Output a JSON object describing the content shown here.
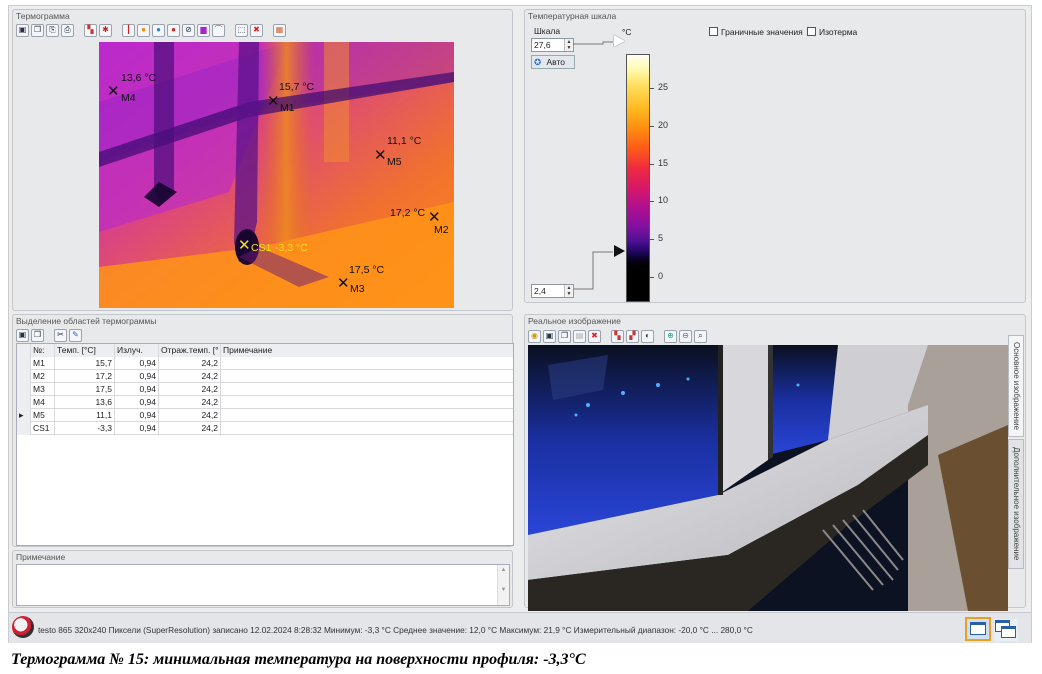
{
  "panels": {
    "thermogram": "Термограмма",
    "scale": "Температурная шкала",
    "regions": "Выделение областей термограммы",
    "note": "Примечание",
    "real_image": "Реальное изображение"
  },
  "scale": {
    "label": "Шкала",
    "unit": "°C",
    "max_value": "27,6",
    "min_value": "2,4",
    "auto_button": "Авто",
    "limits_checkbox": "Граничные значения",
    "isotherm_checkbox": "Изотерма",
    "ticks": [
      "25",
      "20",
      "15",
      "10",
      "5",
      "0"
    ],
    "upper_marker_value": 27.6,
    "lower_marker_value": 2.4,
    "range": [
      -3.3,
      29.5
    ]
  },
  "markers": [
    {
      "name": "M4",
      "value": "13,6 °C"
    },
    {
      "name": "M1",
      "value": "15,7 °C"
    },
    {
      "name": "M5",
      "value": "11,1 °C"
    },
    {
      "name": "M2",
      "value": "17,2 °C"
    },
    {
      "name": "CS1",
      "value": "-3,3 °C"
    },
    {
      "name": "M3",
      "value": "17,5 °C"
    }
  ],
  "table": {
    "columns": [
      "№:",
      "Темп. [°C]",
      "Излуч.",
      "Отраж.темп. [°",
      "Примечание"
    ],
    "rows": [
      {
        "id": "M1",
        "temp": "15,7",
        "emiss": "0,94",
        "refl": "24,2",
        "note": ""
      },
      {
        "id": "M2",
        "temp": "17,2",
        "emiss": "0,94",
        "refl": "24,2",
        "note": ""
      },
      {
        "id": "M3",
        "temp": "17,5",
        "emiss": "0,94",
        "refl": "24,2",
        "note": ""
      },
      {
        "id": "M4",
        "temp": "13,6",
        "emiss": "0,94",
        "refl": "24,2",
        "note": ""
      },
      {
        "id": "M5",
        "temp": "11,1",
        "emiss": "0,94",
        "refl": "24,2",
        "note": ""
      },
      {
        "id": "CS1",
        "temp": "-3,3",
        "emiss": "0,94",
        "refl": "24,2",
        "note": ""
      }
    ],
    "selected_row_marker": "▸"
  },
  "side_tabs": {
    "main": "Основное изображение",
    "additional": "Дополнительное изображение"
  },
  "status": {
    "text": "testo 865 320x240 Пиксели (SuperResolution) записано 12.02.2024 8:28:32  Минимум: -3,3 °C  Среднее значение: 12,0 °C  Максимум: 21,9 °C  Измерительный диапазон: -20,0 °C ... 280,0 °C"
  },
  "caption": "Термограмма № 15: минимальная температура на поверхности профиля: -3,3°C",
  "colors": {
    "marker_black": "#111111",
    "marker_yellow": "#f2e21a",
    "accent": "#1f5fa8"
  }
}
